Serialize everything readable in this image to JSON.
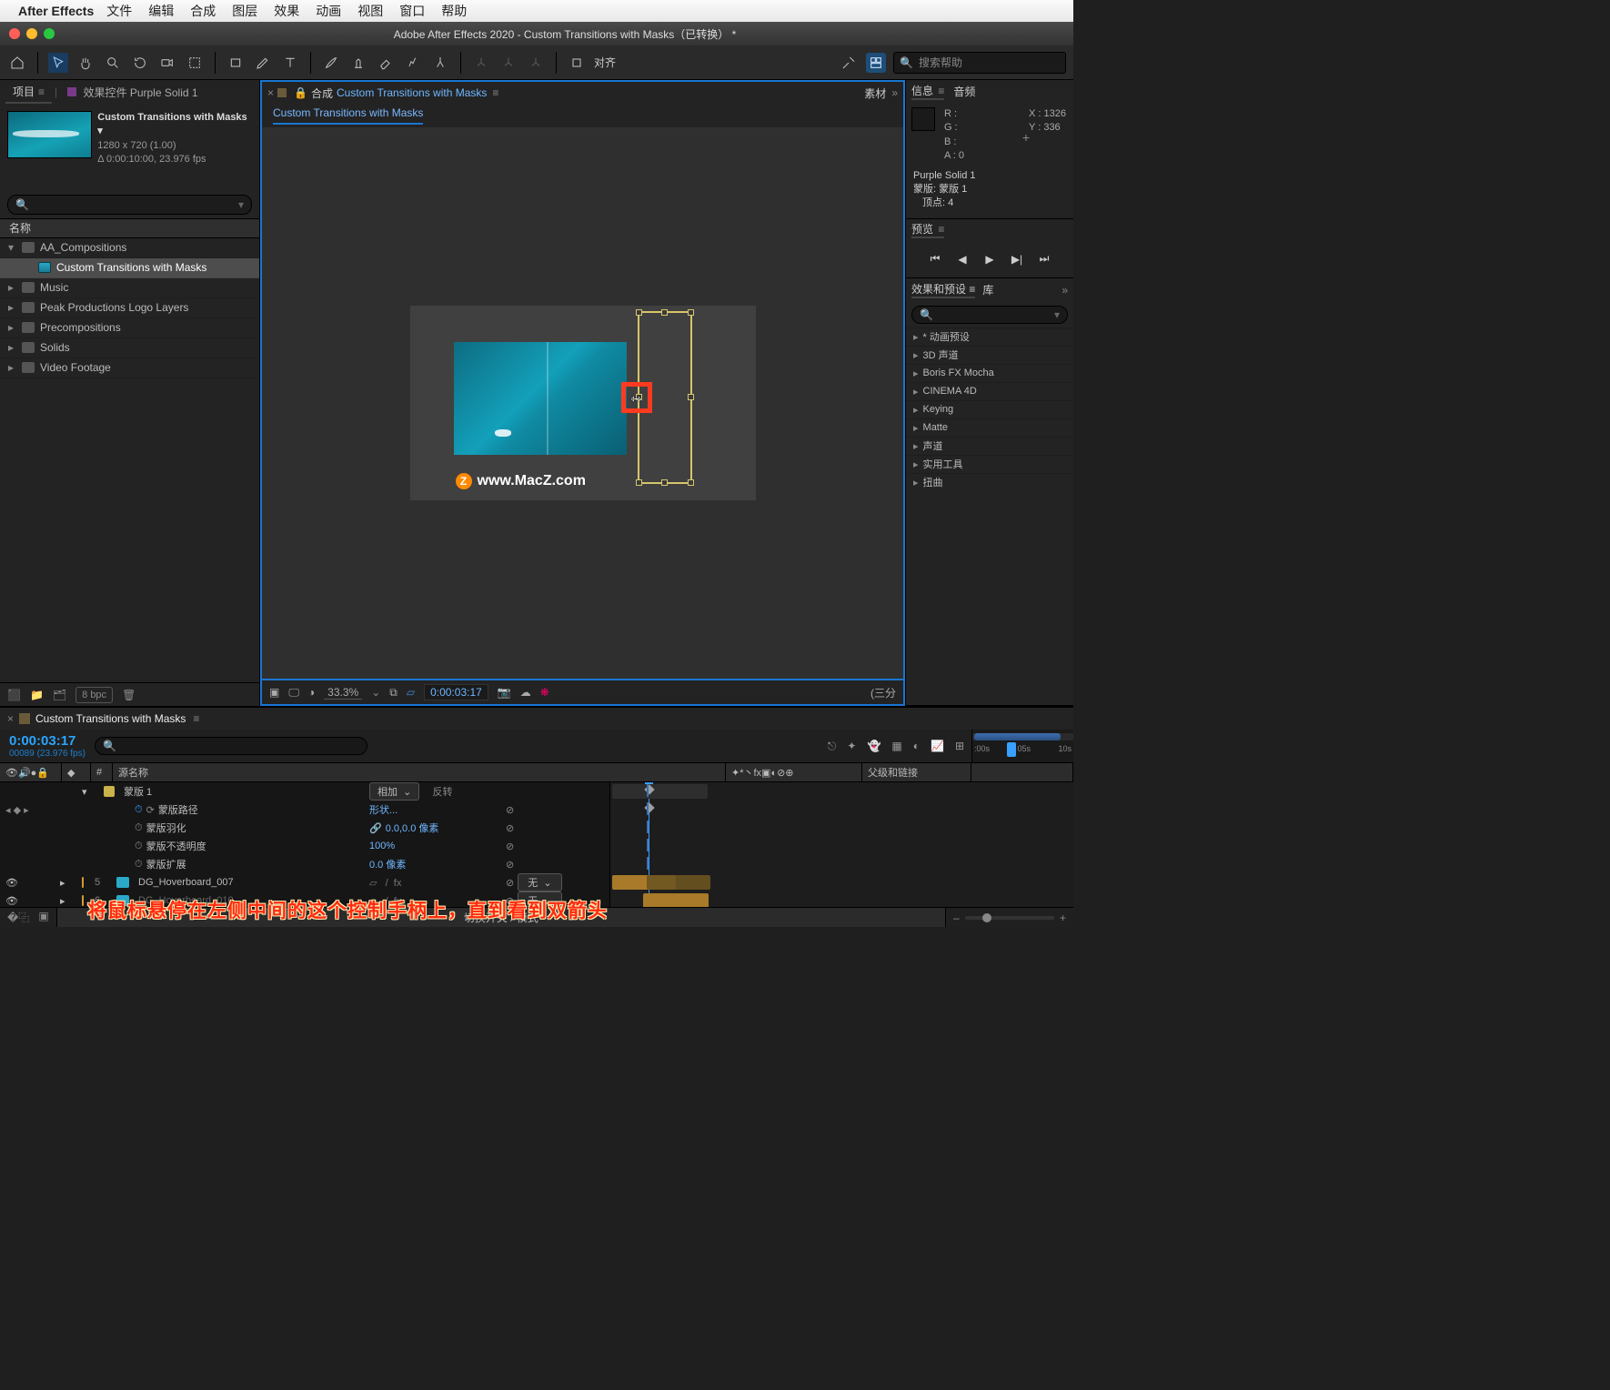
{
  "mac_menu": {
    "app": "After Effects",
    "items": [
      "文件",
      "编辑",
      "合成",
      "图层",
      "效果",
      "动画",
      "视图",
      "窗口",
      "帮助"
    ]
  },
  "window_title": "Adobe After Effects 2020 - Custom Transitions with Masks（已转换） *",
  "toolbar": {
    "snap_label": "对齐",
    "search_placeholder": "搜索帮助"
  },
  "project_panel": {
    "tab_project": "项目",
    "tab_effect_controls": "效果控件 Purple Solid 1",
    "comp_name": "Custom Transitions with Masks",
    "comp_dims": "1280 x 720 (1.00)",
    "comp_dur": "Δ 0:00:10:00, 23.976 fps",
    "search_placeholder": "",
    "col_name": "名称",
    "items": [
      {
        "type": "folder",
        "name": "AA_Compositions",
        "expanded": true
      },
      {
        "type": "comp",
        "name": "Custom Transitions with Masks",
        "indent": 1,
        "selected": true
      },
      {
        "type": "folder",
        "name": "Music"
      },
      {
        "type": "folder",
        "name": "Peak Productions Logo Layers"
      },
      {
        "type": "folder",
        "name": "Precompositions"
      },
      {
        "type": "folder",
        "name": "Solids"
      },
      {
        "type": "folder",
        "name": "Video Footage"
      }
    ],
    "depth_label": "8 bpc"
  },
  "comp_viewer": {
    "tab_label": "合成",
    "tab_name": "Custom Transitions with Masks",
    "right_tab": "素材",
    "breadcrumb": "Custom Transitions with Masks",
    "zoom": "33.3%",
    "time": "0:00:03:17",
    "mode_label": "(三分",
    "watermark": "www.MacZ.com"
  },
  "info_panel": {
    "tab_info": "信息",
    "tab_audio": "音频",
    "R": "R :",
    "G": "G :",
    "B": "B :",
    "A": "A :  0",
    "X": "X : 1326",
    "Y": "Y : 336",
    "sel_layer": "Purple Solid 1",
    "sel_mask": "蒙版: 蒙版 1",
    "sel_vert": "顶点: 4"
  },
  "preview_panel": {
    "tab": "预览"
  },
  "fx_panel": {
    "tab_fx": "效果和预设",
    "tab_lib": "库",
    "cats": [
      "* 动画预设",
      "3D 声道",
      "Boris FX Mocha",
      "CINEMA 4D",
      "Keying",
      "Matte",
      "声道",
      "实用工具",
      "扭曲"
    ]
  },
  "timeline": {
    "tab_name": "Custom Transitions with Masks",
    "timecode": "0:00:03:17",
    "frames": "00089 (23.976 fps)",
    "ruler_ticks": [
      ":00s",
      "05s",
      "10s"
    ],
    "col_src": "源名称",
    "col_parent": "父级和链接",
    "col_num": "#",
    "mask_row": {
      "name": "蒙版 1",
      "mode": "相加",
      "invert": "反转"
    },
    "props": [
      {
        "name": "蒙版路径",
        "value": "形状...",
        "stopwatch": true,
        "keyed": true
      },
      {
        "name": "蒙版羽化",
        "value": "0.0,0.0 像素",
        "link": true
      },
      {
        "name": "蒙版不透明度",
        "value": "100%"
      },
      {
        "name": "蒙版扩展",
        "value": "0.0 像素"
      }
    ],
    "layers": [
      {
        "num": "5",
        "name": "DG_Hoverboard_007",
        "color": "#d69a2d",
        "parent": "无"
      },
      {
        "num": "6",
        "name": "DG_Hoverboard_010",
        "color": "#d69a2d",
        "parent": "无",
        "dim": true
      }
    ],
    "footer_center": "切换开关 / 模式"
  },
  "annotation": "将鼠标悬停在左侧中间的这个控制手柄上，直到看到双箭头"
}
